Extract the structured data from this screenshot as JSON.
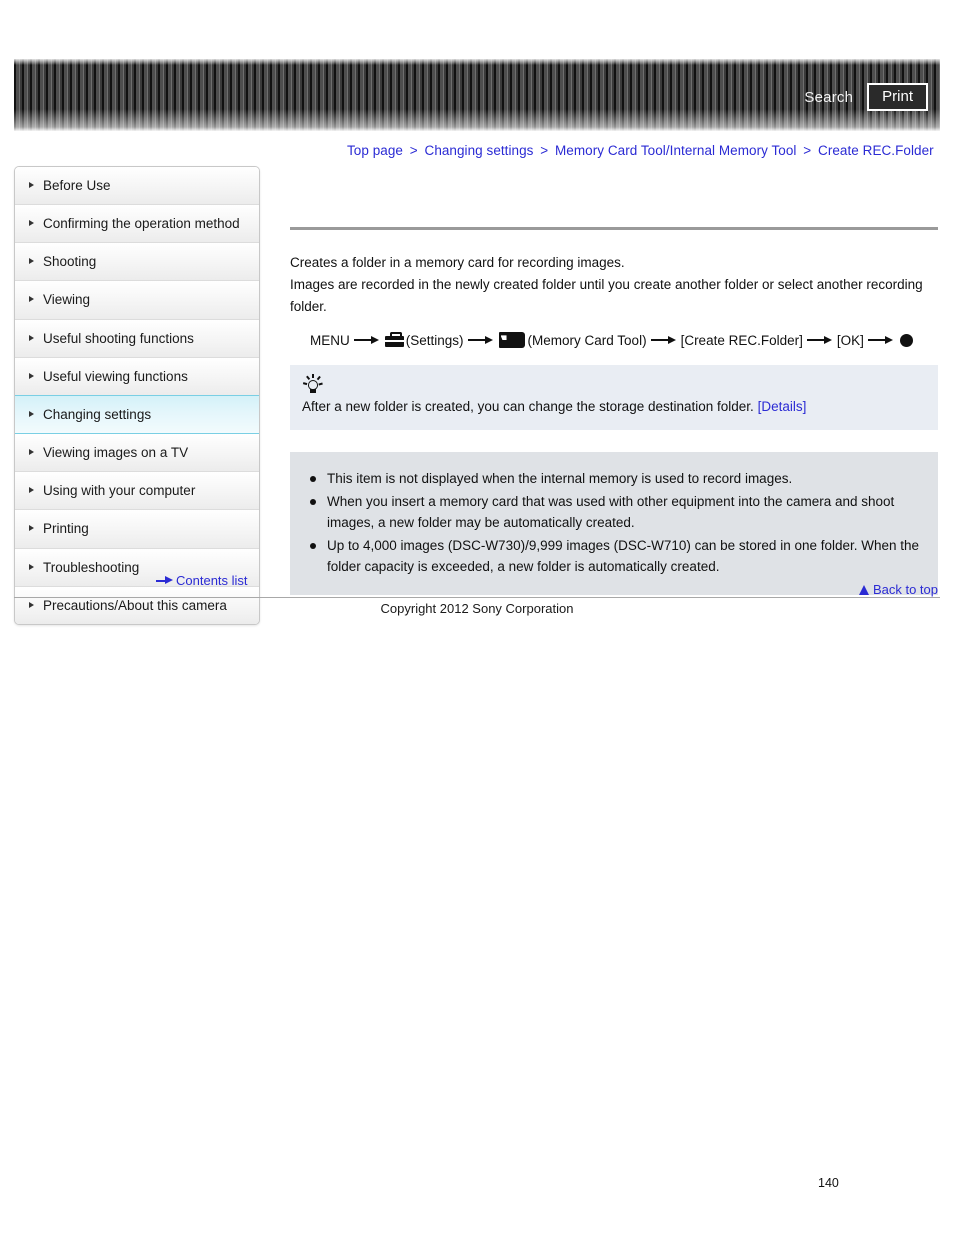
{
  "header": {
    "search_label": "Search",
    "print_label": "Print",
    "search_icon": "search-icon",
    "print_icon": "print-icon"
  },
  "breadcrumb": {
    "separator": ">",
    "items": [
      {
        "label": "Top page"
      },
      {
        "label": "Changing settings"
      },
      {
        "label": "Memory Card Tool/Internal Memory Tool"
      },
      {
        "label": "Create REC.Folder"
      }
    ]
  },
  "sidebar": {
    "items": [
      {
        "label": "Before Use",
        "active": false
      },
      {
        "label": "Confirming the operation method",
        "active": false
      },
      {
        "label": "Shooting",
        "active": false
      },
      {
        "label": "Viewing",
        "active": false
      },
      {
        "label": "Useful shooting functions",
        "active": false
      },
      {
        "label": "Useful viewing functions",
        "active": false
      },
      {
        "label": "Changing settings",
        "active": true
      },
      {
        "label": "Viewing images on a TV",
        "active": false
      },
      {
        "label": "Using with your computer",
        "active": false
      },
      {
        "label": "Printing",
        "active": false
      },
      {
        "label": "Troubleshooting",
        "active": false
      },
      {
        "label": "Precautions/About this camera",
        "active": false
      }
    ],
    "active_color": "#79cfe4"
  },
  "main": {
    "intro_line_1": "Creates a folder in a memory card for recording images.",
    "intro_line_2": "Images are recorded in the newly created folder until you create another folder or select another recording folder.",
    "menu_path": {
      "menu_label": "MENU",
      "settings_label": "(Settings)",
      "settings_icon": "toolbox-icon",
      "memory_card_tool_label": "(Memory Card Tool)",
      "memory_card_icon": "memory-card-icon",
      "create_rec_folder_label": "[Create REC.Folder]",
      "ok_label": "[OK]",
      "end_icon": "filled-circle-icon",
      "arrow_icon": "right-arrow-icon"
    },
    "tip": {
      "icon": "light-bulb-icon",
      "text": "After a new folder is created, you can change the storage destination folder.",
      "link_label": "[Details]"
    },
    "notes": [
      "This item is not displayed when the internal memory is used to record images.",
      "When you insert a memory card that was used with other equipment into the camera and shoot images, a new folder may be automatically created.",
      "Up to 4,000 images (DSC-W730)/9,999 images (DSC-W710) can be stored in one folder. When the folder capacity is exceeded, a new folder is automatically created."
    ]
  },
  "footer": {
    "contents_list_label": "Contents list",
    "contents_list_icon": "right-arrow-icon",
    "back_to_top_label": "Back to top",
    "back_to_top_icon": "up-triangle-icon",
    "copyright": "Copyright 2012 Sony Corporation",
    "page_number": "140"
  },
  "colors": {
    "link": "#2b2bd4",
    "tip_background": "#e9edf3",
    "notes_background": "#dfe2e6",
    "rule": "#9a9a9a"
  }
}
